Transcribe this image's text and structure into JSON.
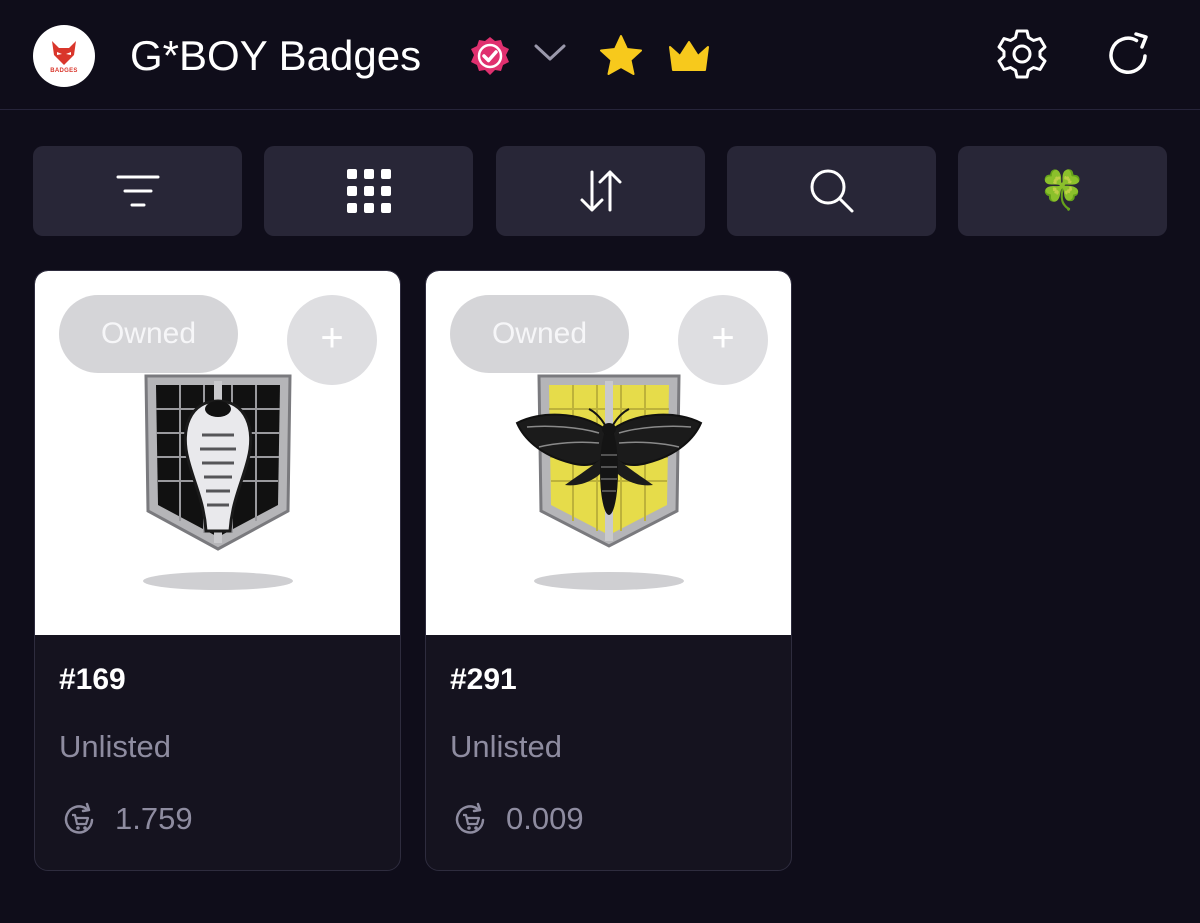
{
  "header": {
    "logo_text": "BADGES",
    "title": "G*BOY Badges",
    "icons": [
      "verified-icon",
      "chevron-down-icon",
      "star-icon",
      "crown-icon",
      "gear-icon",
      "refresh-icon"
    ]
  },
  "toolbar": {
    "buttons": [
      "filter-icon",
      "grid-icon",
      "sort-icon",
      "search-icon",
      "clover-icon"
    ],
    "clover_glyph": "🍀"
  },
  "cards": [
    {
      "id": "#169",
      "owned_label": "Owned",
      "plus_label": "+",
      "status": "Unlisted",
      "price": "1.759",
      "badge": "cobra",
      "accent": "#111111"
    },
    {
      "id": "#291",
      "owned_label": "Owned",
      "plus_label": "+",
      "status": "Unlisted",
      "price": "0.009",
      "badge": "moth",
      "accent": "#e6dc4a"
    }
  ],
  "colors": {
    "background": "#0f0d1a",
    "button_bg": "#282637",
    "verified": "#e0306f",
    "star": "#f7c91c",
    "crown": "#f7c91c",
    "muted_text": "#8e8ca0"
  }
}
